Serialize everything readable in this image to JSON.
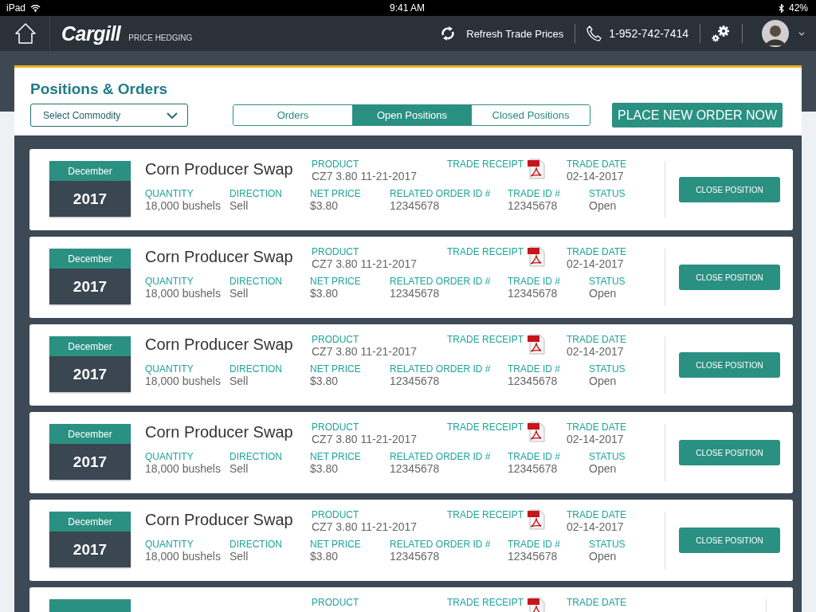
{
  "status_bar": {
    "device": "iPad",
    "time": "9:41 AM",
    "battery": "42%"
  },
  "header": {
    "logo": "Cargill",
    "app_name": "PRICE HEDGING",
    "refresh": "Refresh Trade Prices",
    "phone": "1-952-742-7414"
  },
  "page": {
    "title": "Positions & Orders",
    "commodity_select": "Select Commodity",
    "tabs": [
      {
        "label": "Orders",
        "selected": false
      },
      {
        "label": "Open Positions",
        "selected": true
      },
      {
        "label": "Closed Positions",
        "selected": false
      }
    ],
    "cta": "PLACE NEW ORDER NOW"
  },
  "cards": [
    {
      "month": "December",
      "year": "2017",
      "title": "Corn Producer Swap",
      "top": [
        {
          "kind": "text",
          "label": "PRODUCT",
          "value": "CZ7 3.80 11-21-2017"
        },
        {
          "kind": "receipt",
          "label": "TRADE RECEIPT"
        },
        {
          "kind": "text",
          "label": "TRADE DATE",
          "value": "02-14-2017"
        }
      ],
      "bottom": [
        {
          "label": "QUANTITY",
          "value": "18,000 bushels"
        },
        {
          "label": "DIRECTION",
          "value": "Sell"
        },
        {
          "label": "NET PRICE",
          "value": "$3.80"
        },
        {
          "label": "RELATED ORDER ID #",
          "value": "12345678"
        },
        {
          "label": "TRADE ID #",
          "value": "12345678"
        },
        {
          "label": "STATUS",
          "value": "Open"
        }
      ],
      "button": "CLOSE POSITION"
    },
    {
      "month": "December",
      "year": "2017",
      "title": "Corn Producer Swap",
      "top": [
        {
          "kind": "text",
          "label": "PRODUCT",
          "value": "CZ7 3.80 11-21-2017"
        },
        {
          "kind": "receipt",
          "label": "TRADE RECEIPT"
        },
        {
          "kind": "text",
          "label": "TRADE DATE",
          "value": "02-14-2017"
        }
      ],
      "bottom": [
        {
          "label": "QUANTITY",
          "value": "18,000 bushels"
        },
        {
          "label": "DIRECTION",
          "value": "Sell"
        },
        {
          "label": "NET PRICE",
          "value": "$3.80"
        },
        {
          "label": "RELATED ORDER ID #",
          "value": "12345678"
        },
        {
          "label": "TRADE ID #",
          "value": "12345678"
        },
        {
          "label": "STATUS",
          "value": "Open"
        }
      ],
      "button": "CLOSE POSITION"
    },
    {
      "month": "December",
      "year": "2017",
      "title": "Corn Producer Swap",
      "top": [
        {
          "kind": "text",
          "label": "PRODUCT",
          "value": "CZ7 3.80 11-21-2017"
        },
        {
          "kind": "receipt",
          "label": "TRADE RECEIPT"
        },
        {
          "kind": "text",
          "label": "TRADE DATE",
          "value": "02-14-2017"
        }
      ],
      "bottom": [
        {
          "label": "QUANTITY",
          "value": "18,000 bushels"
        },
        {
          "label": "DIRECTION",
          "value": "Sell"
        },
        {
          "label": "NET PRICE",
          "value": "$3.80"
        },
        {
          "label": "RELATED ORDER ID #",
          "value": "12345678"
        },
        {
          "label": "TRADE ID #",
          "value": "12345678"
        },
        {
          "label": "STATUS",
          "value": "Open"
        }
      ],
      "button": "CLOSE POSITION"
    },
    {
      "month": "December",
      "year": "2017",
      "title": "Corn Producer Swap",
      "top": [
        {
          "kind": "text",
          "label": "PRODUCT",
          "value": "CZ7 3.80 11-21-2017"
        },
        {
          "kind": "receipt",
          "label": "TRADE RECEIPT"
        },
        {
          "kind": "text",
          "label": "TRADE DATE",
          "value": "02-14-2017"
        }
      ],
      "bottom": [
        {
          "label": "QUANTITY",
          "value": "18,000 bushels"
        },
        {
          "label": "DIRECTION",
          "value": "Sell"
        },
        {
          "label": "NET PRICE",
          "value": "$3.80"
        },
        {
          "label": "RELATED ORDER ID #",
          "value": "12345678"
        },
        {
          "label": "TRADE ID #",
          "value": "12345678"
        },
        {
          "label": "STATUS",
          "value": "Open"
        }
      ],
      "button": "CLOSE POSITION"
    },
    {
      "month": "December",
      "year": "2017",
      "title": "Corn Producer Swap",
      "top": [
        {
          "kind": "text",
          "label": "PRODUCT",
          "value": "CZ7 3.80 11-21-2017"
        },
        {
          "kind": "receipt",
          "label": "TRADE RECEIPT"
        },
        {
          "kind": "text",
          "label": "TRADE DATE",
          "value": "02-14-2017"
        }
      ],
      "bottom": [
        {
          "label": "QUANTITY",
          "value": "18,000 bushels"
        },
        {
          "label": "DIRECTION",
          "value": "Sell"
        },
        {
          "label": "NET PRICE",
          "value": "$3.80"
        },
        {
          "label": "RELATED ORDER ID #",
          "value": "12345678"
        },
        {
          "label": "TRADE ID #",
          "value": "12345678"
        },
        {
          "label": "STATUS",
          "value": "Open"
        }
      ],
      "button": "CLOSE POSITION"
    },
    {
      "top": [
        {
          "kind": "text",
          "label": "PRODUCT"
        },
        {
          "kind": "receipt",
          "label": "TRADE RECEIPT"
        },
        {
          "kind": "text",
          "label": "TRADE DATE"
        }
      ]
    }
  ]
}
